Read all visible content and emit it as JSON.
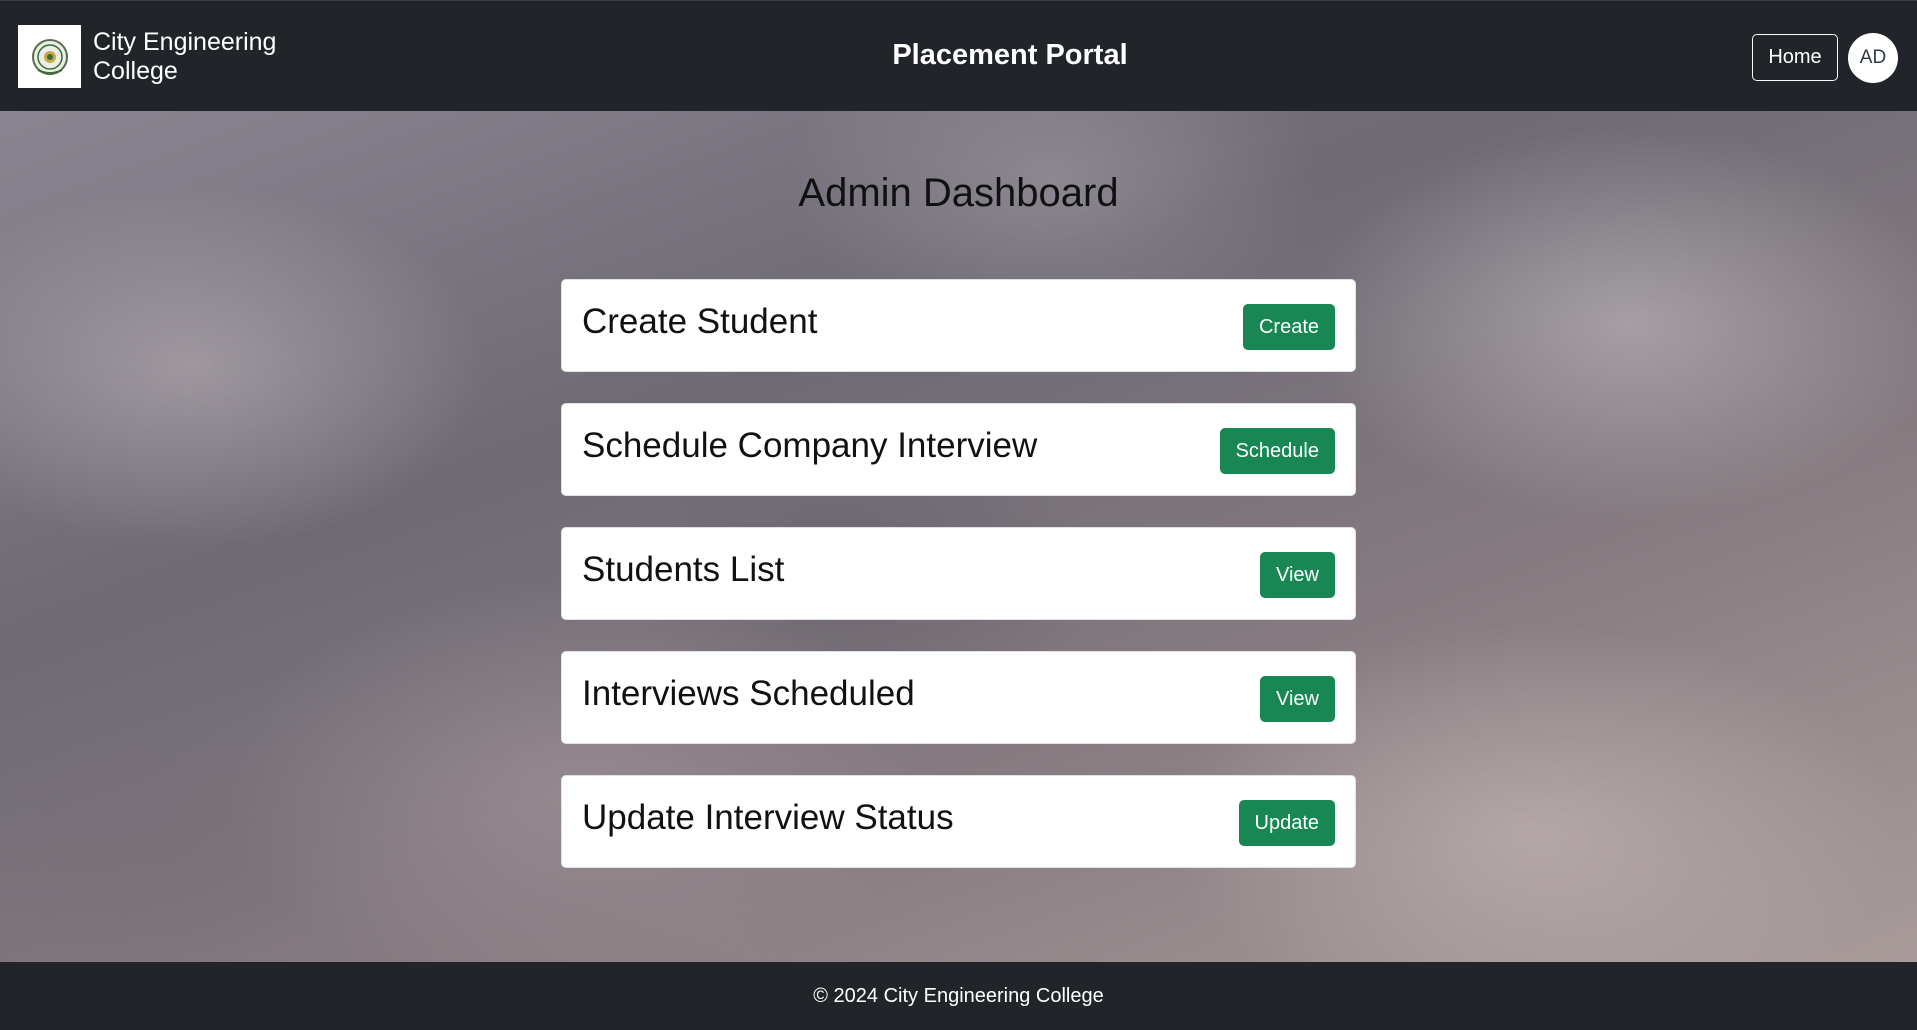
{
  "navbar": {
    "brand_name": "City Engineering College",
    "portal_title": "Placement Portal",
    "home_label": "Home",
    "avatar_initials": "AD"
  },
  "main": {
    "title": "Admin Dashboard",
    "cards": [
      {
        "title": "Create Student",
        "button": "Create"
      },
      {
        "title": "Schedule Company Interview",
        "button": "Schedule"
      },
      {
        "title": "Students List",
        "button": "View"
      },
      {
        "title": "Interviews Scheduled",
        "button": "View"
      },
      {
        "title": "Update Interview Status",
        "button": "Update"
      }
    ]
  },
  "footer": {
    "text": "© 2024 City Engineering College"
  },
  "colors": {
    "navbar_bg": "#212529",
    "button_green": "#198754"
  }
}
